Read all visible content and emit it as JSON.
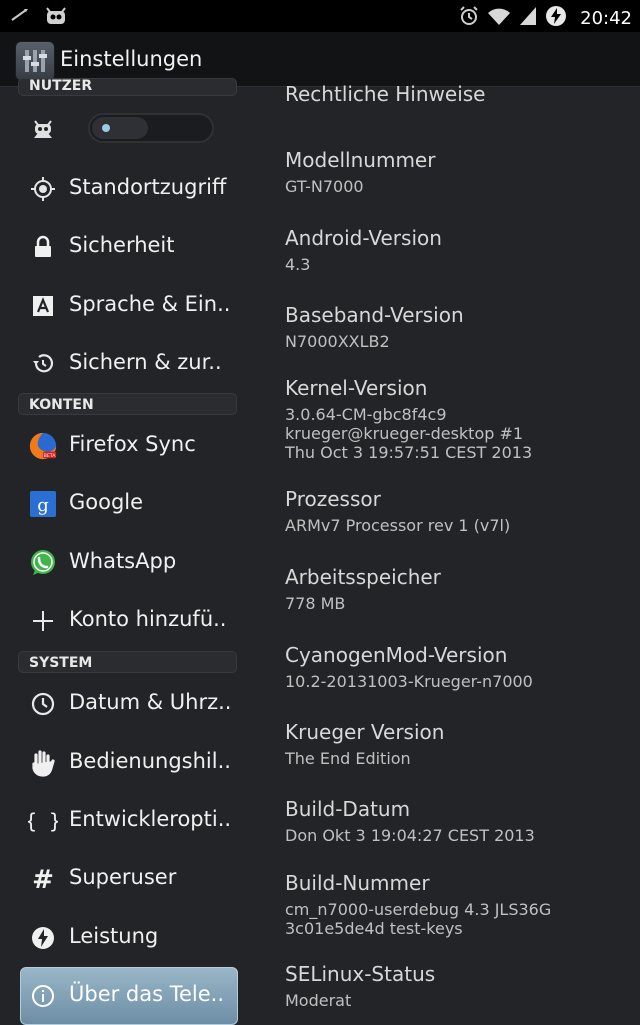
{
  "status_bar": {
    "time": "20:42",
    "left_icons": [
      "pen-icon",
      "cyanogen-icon"
    ],
    "right_icons": [
      "alarm-icon",
      "wifi-icon",
      "signal-icon",
      "sync-icon"
    ]
  },
  "action_bar": {
    "title": "Einstellungen",
    "icon": "settings-app-icon"
  },
  "sidebar": {
    "header_nutzer": "NUTZER",
    "user_toggle": {
      "icon": "android-user-icon",
      "state": "off"
    },
    "items_top": [
      {
        "label": "Standortzugriff",
        "icon": "location-icon"
      },
      {
        "label": "Sicherheit",
        "icon": "lock-icon"
      },
      {
        "label": "Sprache & Ein..",
        "icon": "language-icon"
      },
      {
        "label": "Sichern & zur..",
        "icon": "restore-icon"
      }
    ],
    "header_konten": "KONTEN",
    "items_accounts": [
      {
        "label": "Firefox Sync",
        "icon": "firefox-icon"
      },
      {
        "label": "Google",
        "icon": "google-icon"
      },
      {
        "label": "WhatsApp",
        "icon": "whatsapp-icon"
      },
      {
        "label": "Konto hinzufü..",
        "icon": "plus-icon"
      }
    ],
    "header_system": "SYSTEM",
    "items_system": [
      {
        "label": "Datum & Uhrz..",
        "icon": "clock-icon"
      },
      {
        "label": "Bedienungshil..",
        "icon": "hand-icon"
      },
      {
        "label": "Entwickleropti..",
        "icon": "braces-icon"
      },
      {
        "label": "Superuser",
        "icon": "hash-icon"
      },
      {
        "label": "Leistung",
        "icon": "performance-icon"
      },
      {
        "label": "Über das Tele..",
        "icon": "info-icon",
        "selected": true
      }
    ],
    "colors": {
      "selected_bg": "#88a8bc"
    }
  },
  "about": {
    "partial_title": "Rechtliche Hinweise",
    "entries": [
      {
        "title": "Modellnummer",
        "value": "GT-N7000"
      },
      {
        "title": "Android-Version",
        "value": "4.3"
      },
      {
        "title": "Baseband-Version",
        "value": "N7000XXLB2"
      },
      {
        "title": "Kernel-Version",
        "value": "3.0.64-CM-gbc8f4c9\nkrueger@krueger-desktop #1\nThu Oct 3 19:57:51 CEST 2013"
      },
      {
        "title": "Prozessor",
        "value": "ARMv7 Processor rev 1 (v7l)"
      },
      {
        "title": "Arbeitsspeicher",
        "value": "778 MB"
      },
      {
        "title": "CyanogenMod-Version",
        "value": "10.2-20131003-Krueger-n7000"
      },
      {
        "title": "Krueger Version",
        "value": "The End Edition"
      },
      {
        "title": "Build-Datum",
        "value": "Don Okt  3 19:04:27 CEST 2013"
      },
      {
        "title": "Build-Nummer",
        "value": "cm_n7000-userdebug 4.3 JLS36G\n3c01e5de4d test-keys"
      },
      {
        "title": "SELinux-Status",
        "value": "Moderat"
      }
    ]
  }
}
